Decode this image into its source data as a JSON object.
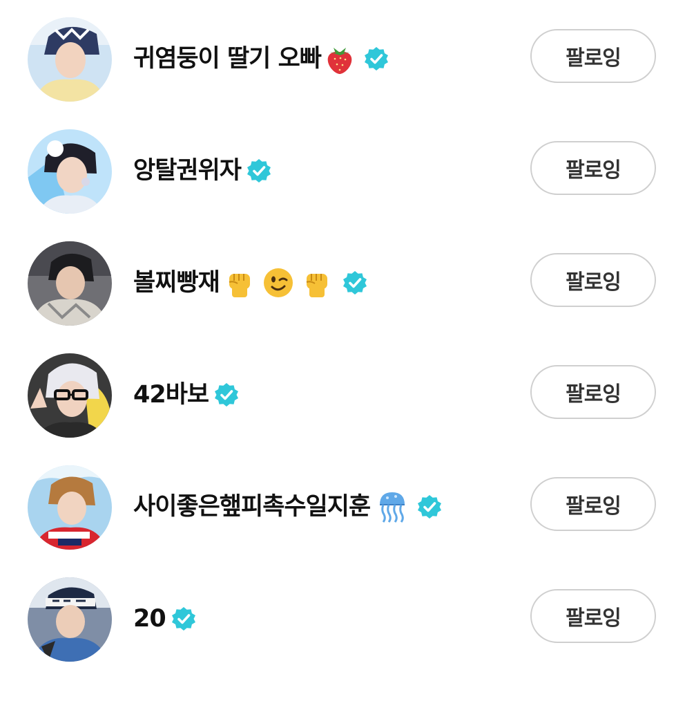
{
  "follow_list": {
    "items": [
      {
        "name": "귀염둥이 딸기 오빠",
        "emoji": [
          "strawberry-icon"
        ],
        "verified": true,
        "button_label": "팔로잉"
      },
      {
        "name": "앙탈권위자",
        "emoji": [],
        "verified": true,
        "button_label": "팔로잉"
      },
      {
        "name": "볼찌빵재",
        "emoji": [
          "raised-fist-icon",
          "winking-face-icon",
          "raised-fist-icon"
        ],
        "verified": true,
        "button_label": "팔로잉"
      },
      {
        "name": "42바보",
        "emoji": [],
        "verified": true,
        "button_label": "팔로잉"
      },
      {
        "name": "사이좋은햎피촉수일지훈",
        "emoji": [
          "jellyfish-icon"
        ],
        "verified": true,
        "button_label": "팔로잉"
      },
      {
        "name": "20",
        "emoji": [],
        "verified": true,
        "button_label": "팔로잉"
      }
    ]
  },
  "colors": {
    "verified_badge": "#2fc7d9",
    "button_border": "#cfcfcf",
    "button_text": "#333333",
    "name_text": "#111111"
  }
}
